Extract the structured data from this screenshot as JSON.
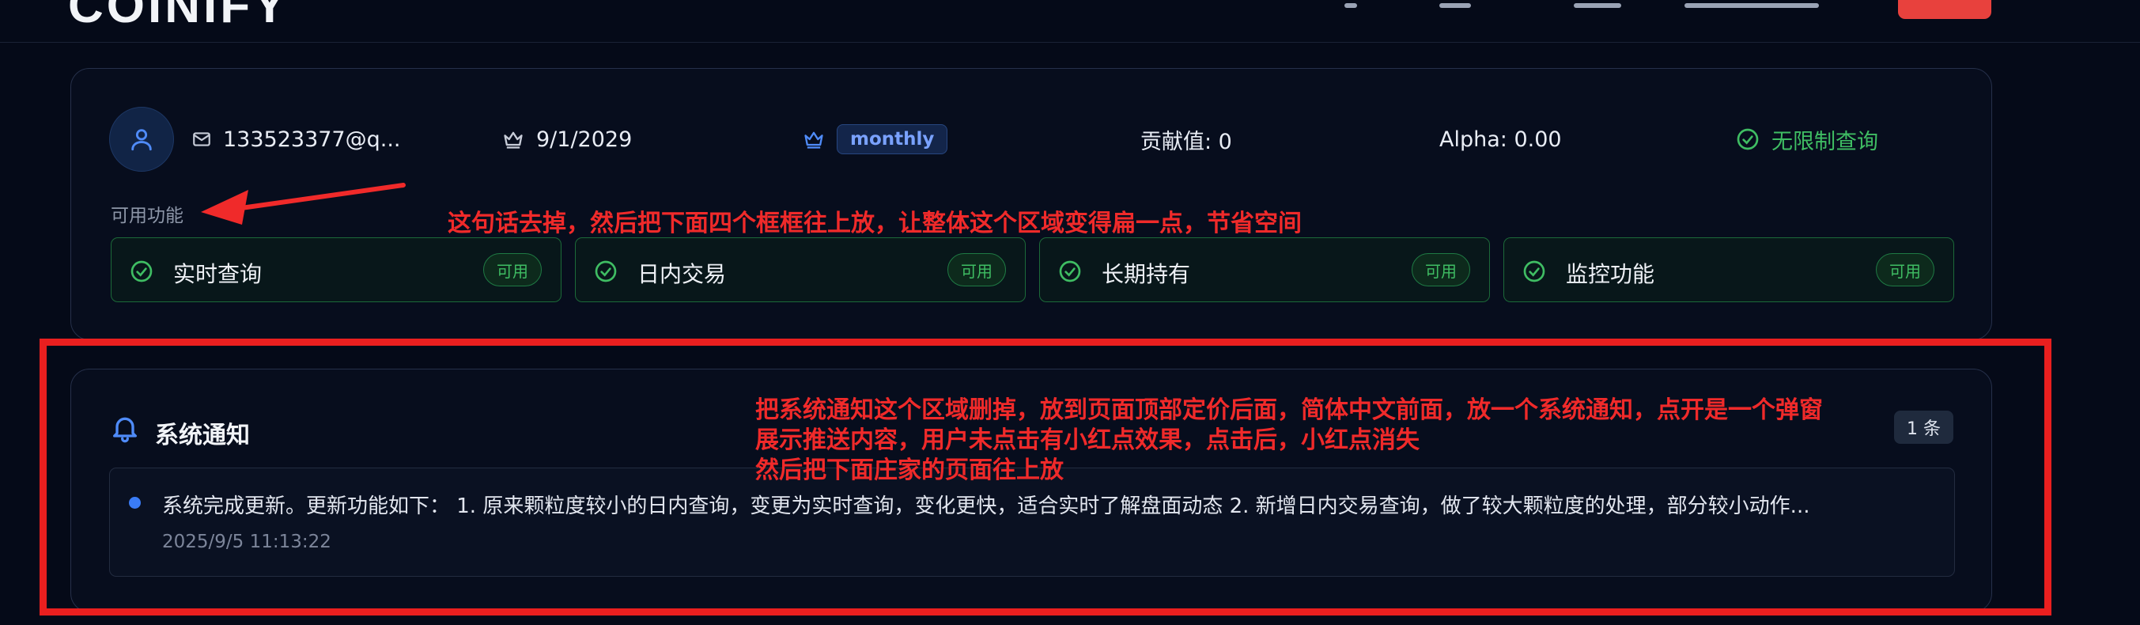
{
  "nav": {
    "logo": "COINIFY"
  },
  "profile": {
    "email": "133523377@q...",
    "expiry": "9/1/2029",
    "plan": "monthly",
    "contribution": "贡献值: 0",
    "alpha": "Alpha: 0.00",
    "query_status": "无限制查询",
    "section_label": "可用功能",
    "features": [
      {
        "name": "实时查询",
        "badge": "可用"
      },
      {
        "name": "日内交易",
        "badge": "可用"
      },
      {
        "name": "长期持有",
        "badge": "可用"
      },
      {
        "name": "监控功能",
        "badge": "可用"
      }
    ]
  },
  "notice": {
    "title": "系统通知",
    "count": "1 条",
    "item_text": "系统完成更新。更新功能如下： 1. 原来颗粒度较小的日内查询，变更为实时查询，变化更快，适合实时了解盘面动态 2. 新增日内交易查询，做了较大颗粒度的处理，部分较小动作...",
    "item_time": "2025/9/5 11:13:22"
  },
  "annotations": {
    "a1": "这句话去掉，然后把下面四个框框往上放，让整体这个区域变得扁一点，节省空间",
    "a2_line1": "把系统通知这个区域删掉，放到页面顶部定价后面，简体中文前面，放一个系统通知，点开是一个弹窗",
    "a2_line2": "展示推送内容，用户未点击有小红点效果，点击后，小红点消失",
    "a2_line3": "然后把下面庄家的页面往上放"
  },
  "colors": {
    "accent_blue": "#3a7cf6",
    "success_green": "#3fbd63",
    "annotation_red": "#f02a2a",
    "brand_red": "#e8413d"
  },
  "icons": [
    "user-icon",
    "mail-icon",
    "crown-icon",
    "check-circle-icon",
    "bell-icon"
  ]
}
